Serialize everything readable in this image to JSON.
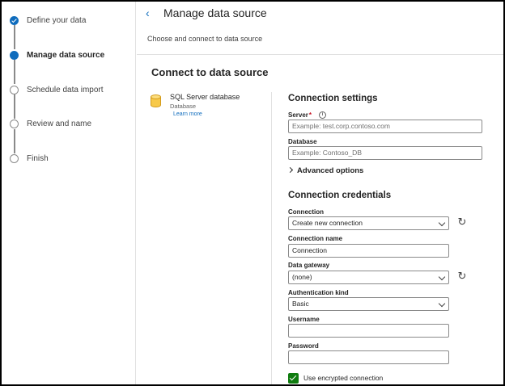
{
  "wizard": {
    "steps": [
      {
        "label": "Define your data",
        "state": "done"
      },
      {
        "label": "Manage data source",
        "state": "current"
      },
      {
        "label": "Schedule data import",
        "state": "pending"
      },
      {
        "label": "Review and name",
        "state": "pending"
      },
      {
        "label": "Finish",
        "state": "pending"
      }
    ]
  },
  "header": {
    "back_icon": "chevron-left-icon",
    "title": "Manage data source",
    "subtitle": "Choose and connect to data source"
  },
  "main": {
    "section_title": "Connect to data source",
    "data_source": {
      "icon": "database-icon",
      "name": "SQL Server database",
      "type": "Database",
      "learn_more": "Learn more"
    }
  },
  "connection_settings": {
    "heading": "Connection settings",
    "server": {
      "label": "Server",
      "required_mark": "*",
      "info_icon": "info-icon",
      "placeholder": "Example: test.corp.contoso.com",
      "value": ""
    },
    "database": {
      "label": "Database",
      "placeholder": "Example: Contoso_DB",
      "value": ""
    },
    "advanced_options": "Advanced options"
  },
  "connection_credentials": {
    "heading": "Connection credentials",
    "connection": {
      "label": "Connection",
      "value": "Create new connection"
    },
    "connection_name": {
      "label": "Connection name",
      "value": "Connection"
    },
    "data_gateway": {
      "label": "Data gateway",
      "value": "(none)"
    },
    "authentication_kind": {
      "label": "Authentication kind",
      "value": "Basic"
    },
    "username": {
      "label": "Username",
      "value": ""
    },
    "password": {
      "label": "Password",
      "value": ""
    },
    "encrypted": {
      "label": "Use encrypted connection",
      "checked": true
    }
  },
  "colors": {
    "accent": "#0f6cbd",
    "check": "#107c10",
    "required": "#c50f1f"
  }
}
